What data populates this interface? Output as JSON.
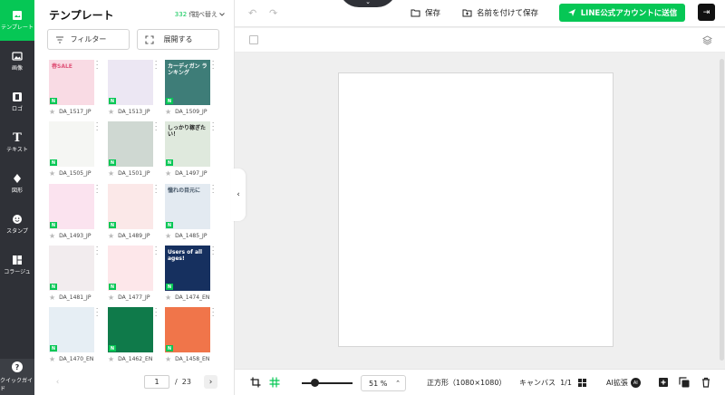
{
  "rail": {
    "items": [
      {
        "label": "テンプレート",
        "icon": "template-icon",
        "active": true
      },
      {
        "label": "画像",
        "icon": "image-icon"
      },
      {
        "label": "ロゴ",
        "icon": "logo-icon"
      },
      {
        "label": "テキスト",
        "icon": "text-icon"
      },
      {
        "label": "図形",
        "icon": "shape-icon"
      },
      {
        "label": "スタンプ",
        "icon": "stamp-icon"
      },
      {
        "label": "コラージュ",
        "icon": "collage-icon"
      }
    ],
    "guide_label": "クイックガイド",
    "guide_glyph": "?"
  },
  "panel": {
    "title": "テンプレート",
    "count": "332",
    "count_unit": "件",
    "sort_label": "並べ替え",
    "filter_label": "フィルター",
    "expand_label": "展開する",
    "templates": [
      {
        "name": "DA_1517_JP",
        "text": "春SALE",
        "bg": "#f9dbe4",
        "fg": "#e0557a",
        "badge": "N"
      },
      {
        "name": "DA_1513_JP",
        "text": "",
        "bg": "#ece7f3",
        "fg": "#7b4fb8",
        "badge": "N"
      },
      {
        "name": "DA_1509_JP",
        "text": "カーディガン ランキング",
        "bg": "#3e7d78",
        "fg": "#ffffff",
        "badge": "N"
      },
      {
        "name": "DA_1505_JP",
        "text": "",
        "bg": "#f5f6f3",
        "fg": "#3b6fb0",
        "badge": "N"
      },
      {
        "name": "DA_1501_JP",
        "text": "",
        "bg": "#cfd8d2",
        "fg": "#2f4a3d",
        "badge": "N"
      },
      {
        "name": "DA_1497_JP",
        "text": "しっかり稼ぎたい！",
        "bg": "#dfe9dd",
        "fg": "#1d1d1d",
        "badge": "N"
      },
      {
        "name": "DA_1493_JP",
        "text": "",
        "bg": "#fbe3ef",
        "fg": "#d03d8a",
        "badge": "N"
      },
      {
        "name": "DA_1489_JP",
        "text": "",
        "bg": "#fbe8e8",
        "fg": "#b04848",
        "badge": "N"
      },
      {
        "name": "DA_1485_JP",
        "text": "憧れの目元に",
        "bg": "#e3eaf1",
        "fg": "#445566",
        "badge": "N"
      },
      {
        "name": "DA_1481_JP",
        "text": "",
        "bg": "#f2ecee",
        "fg": "#c2293c",
        "badge": "N"
      },
      {
        "name": "DA_1477_JP",
        "text": "",
        "bg": "#fde7ea",
        "fg": "#c7374f",
        "badge": "N"
      },
      {
        "name": "DA_1474_EN",
        "text": "Users of all ages!",
        "bg": "#16305f",
        "fg": "#ffffff",
        "badge": "N"
      },
      {
        "name": "DA_1470_EN",
        "text": "",
        "bg": "#e6eef4",
        "fg": "#305b83",
        "badge": "N"
      },
      {
        "name": "DA_1462_EN",
        "text": "",
        "bg": "#0f7a4a",
        "fg": "#ffffff",
        "badge": "N"
      },
      {
        "name": "DA_1458_EN",
        "text": "",
        "bg": "#f0754a",
        "fg": "#ffffff",
        "badge": "N"
      }
    ],
    "pager": {
      "current": "1",
      "separator": "/",
      "total": "23",
      "prev": "‹",
      "next": "›"
    }
  },
  "topbar": {
    "undo": "↶",
    "redo": "↷",
    "notch_glyph": "⌄",
    "save_label": "保存",
    "save_as_label": "名前を付けて保存",
    "send_label": "LINE公式アカウントに送信",
    "exit_glyph": "⇥"
  },
  "canvas": {
    "collapse_glyph": "‹"
  },
  "bottombar": {
    "zoom_value": "51",
    "zoom_unit": "%",
    "zoom_arrow": "⌃",
    "size_label": "正方形（1080×1080）",
    "canvas_label": "キャンバス",
    "canvas_page": "1/1",
    "ai_label": "AI拡張",
    "ai_chip": "AI"
  },
  "colors": {
    "accent": "#06c755",
    "rail": "#2f3137"
  }
}
